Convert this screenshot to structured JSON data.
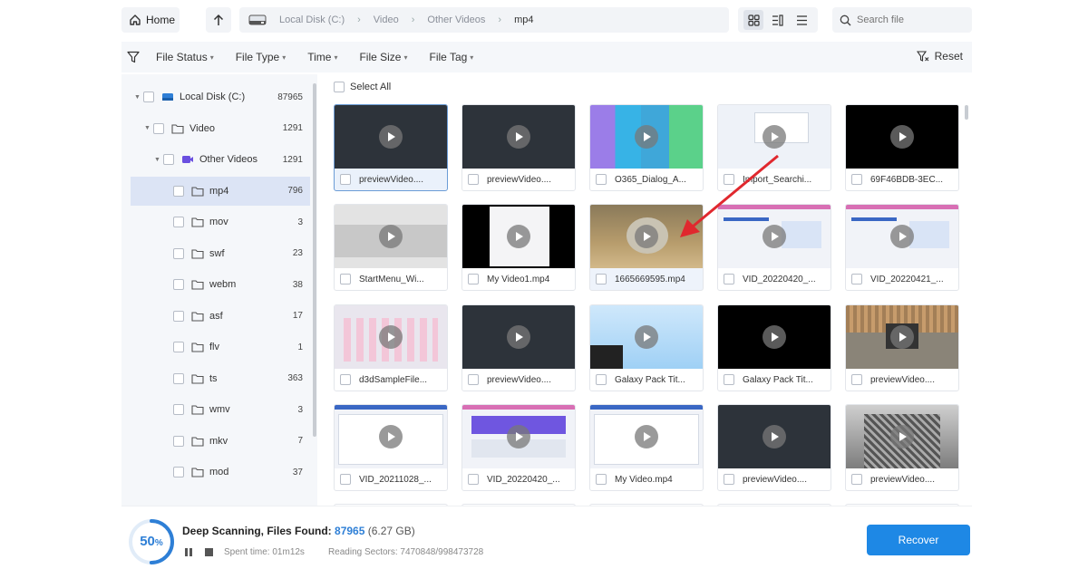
{
  "toolbar": {
    "home_label": "Home",
    "path": [
      "Local Disk (C:)",
      "Video",
      "Other Videos",
      "mp4"
    ],
    "search_placeholder": "Search file"
  },
  "filters": {
    "items": [
      "File Status",
      "File Type",
      "Time",
      "File Size",
      "File Tag"
    ],
    "reset_label": "Reset"
  },
  "sidebar": {
    "items": [
      {
        "label": "Local Disk (C:)",
        "count": "87965"
      },
      {
        "label": "Video",
        "count": "1291"
      },
      {
        "label": "Other Videos",
        "count": "1291"
      },
      {
        "label": "mp4",
        "count": "796"
      },
      {
        "label": "mov",
        "count": "3"
      },
      {
        "label": "swf",
        "count": "23"
      },
      {
        "label": "webm",
        "count": "38"
      },
      {
        "label": "asf",
        "count": "17"
      },
      {
        "label": "flv",
        "count": "1"
      },
      {
        "label": "ts",
        "count": "363"
      },
      {
        "label": "wmv",
        "count": "3"
      },
      {
        "label": "mkv",
        "count": "7"
      },
      {
        "label": "mod",
        "count": "37"
      }
    ]
  },
  "grid": {
    "select_all_label": "Select All",
    "files": [
      "previewVideo....",
      "previewVideo....",
      "O365_Dialog_A...",
      "Import_Searchi...",
      "69F46BDB-3EC...",
      "StartMenu_Wi...",
      "My Video1.mp4",
      "1665669595.mp4",
      "VID_20220420_...",
      "VID_20220421_...",
      "d3dSampleFile...",
      "previewVideo....",
      "Galaxy Pack Tit...",
      "Galaxy Pack Tit...",
      "previewVideo....",
      "VID_20211028_...",
      "VID_20220420_...",
      "My Video.mp4",
      "previewVideo....",
      "previewVideo...."
    ]
  },
  "status": {
    "percent": "50",
    "percent_unit": "%",
    "progress": 0.5,
    "scan_label": "Deep Scanning, Files Found:",
    "found_count": "87965",
    "total_size": "(6.27 GB)",
    "spent_time": "Spent time: 01m12s",
    "reading_sectors": "Reading Sectors: 7470848/998473728",
    "recover_label": "Recover"
  },
  "colors": {
    "accent": "#1e88e5",
    "selected_row": "#dce4f5",
    "annotation_arrow": "#e0282e"
  }
}
